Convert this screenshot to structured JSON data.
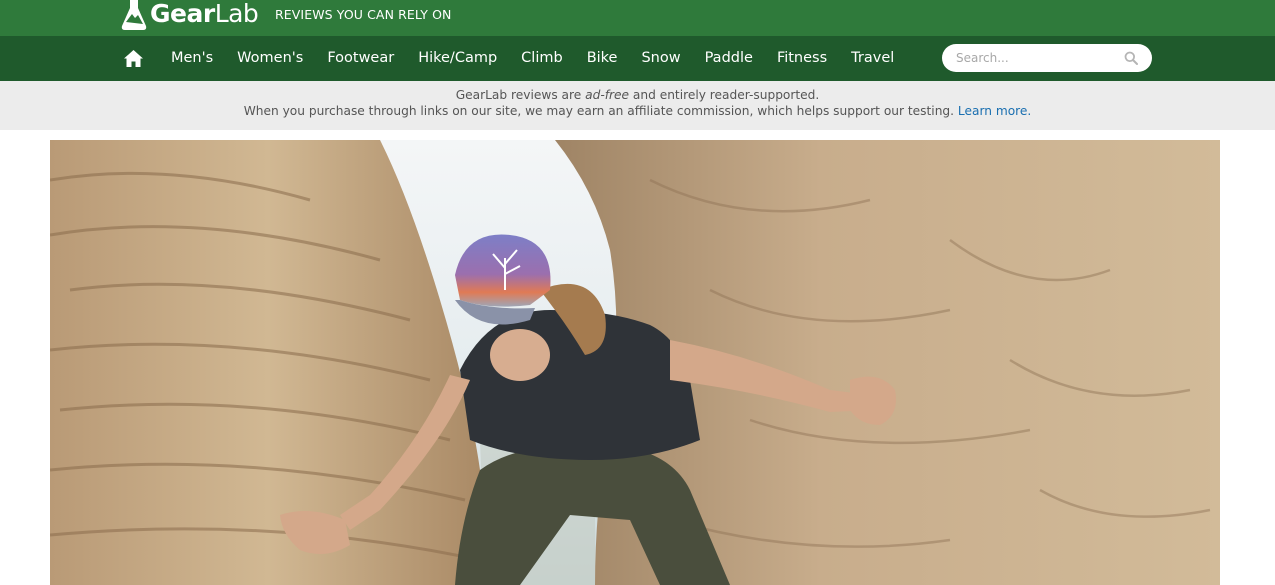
{
  "header": {
    "logo_bold": "Gear",
    "logo_light": "Lab",
    "tagline": "REVIEWS YOU CAN RELY ON"
  },
  "nav": {
    "home_icon": "home-icon",
    "items": [
      {
        "label": "Men's"
      },
      {
        "label": "Women's"
      },
      {
        "label": "Footwear"
      },
      {
        "label": "Hike/Camp"
      },
      {
        "label": "Climb"
      },
      {
        "label": "Bike"
      },
      {
        "label": "Snow"
      },
      {
        "label": "Paddle"
      },
      {
        "label": "Fitness"
      },
      {
        "label": "Travel"
      }
    ],
    "search": {
      "placeholder": "Search...",
      "value": "",
      "icon": "search-icon"
    }
  },
  "disclosure": {
    "line1_before": "GearLab reviews are ",
    "line1_em": "ad-free",
    "line1_after": " and entirely reader-supported.",
    "line2": "When you purchase through links on our site, we may earn an affiliate commission, which helps support our testing.",
    "learn_more": "Learn more."
  },
  "colors": {
    "brand_green": "#2f7a3b",
    "nav_green": "#1f5a2c",
    "disclosure_bg": "#ececec",
    "link_blue": "#1a6fb0"
  }
}
